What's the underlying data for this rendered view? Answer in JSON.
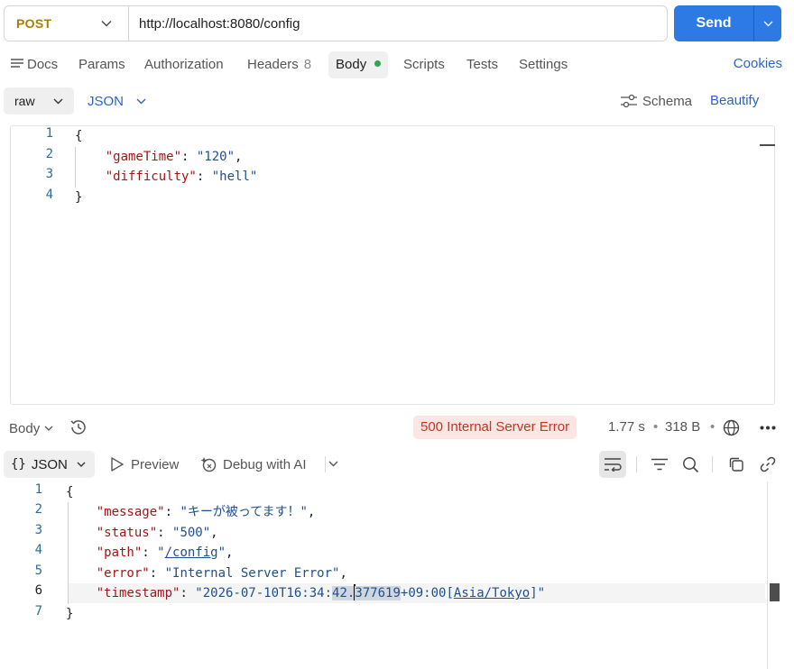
{
  "request": {
    "method": "POST",
    "url": "http://localhost:8080/config",
    "send_label": "Send"
  },
  "tabs": [
    {
      "label": "Docs"
    },
    {
      "label": "Params"
    },
    {
      "label": "Authorization"
    },
    {
      "label": "Headers",
      "count": "8"
    },
    {
      "label": "Body",
      "active": true
    },
    {
      "label": "Scripts"
    },
    {
      "label": "Tests"
    },
    {
      "label": "Settings"
    }
  ],
  "cookies_label": "Cookies",
  "body_toolbar": {
    "mode": "raw",
    "format": "JSON",
    "schema_label": "Schema",
    "beautify_label": "Beautify"
  },
  "request_body": {
    "line_numbers": [
      "1",
      "2",
      "3",
      "4"
    ],
    "open": "{",
    "close": "}",
    "fields": [
      {
        "key": "\"gameTime\"",
        "value": "\"120\""
      },
      {
        "key": "\"difficulty\"",
        "value": "\"hell\""
      }
    ]
  },
  "response": {
    "section_label": "Body",
    "status": "500 Internal Server Error",
    "time": "1.77 s",
    "size": "318 B",
    "format": "JSON",
    "preview_label": "Preview",
    "debug_label": "Debug with AI",
    "line_numbers": [
      "1",
      "2",
      "3",
      "4",
      "5",
      "6",
      "7"
    ],
    "open": "{",
    "close": "}",
    "fields": [
      {
        "key": "\"message\"",
        "value": "\"キーが被ってます！\""
      },
      {
        "key": "\"status\"",
        "value": "\"500\""
      },
      {
        "key": "\"path\"",
        "value_pre": "\"",
        "value_link": "/config",
        "value_post": "\""
      },
      {
        "key": "\"error\"",
        "value": "\"Internal Server Error\""
      },
      {
        "key": "\"timestamp\"",
        "value_pre": "\"2026-07-10T16:34:",
        "value_sel1": "42.",
        "value_sel2": "377619",
        "value_mid": "+09:00[",
        "value_link": "Asia/Tokyo",
        "value_post": "]\""
      }
    ]
  },
  "colors": {
    "accent": "#2d7ae5",
    "method": "#a87f00",
    "error_bg": "#fbe6e4",
    "error_text": "#c9341c",
    "json_key": "#a31515",
    "json_string": "#1e4f8f"
  }
}
